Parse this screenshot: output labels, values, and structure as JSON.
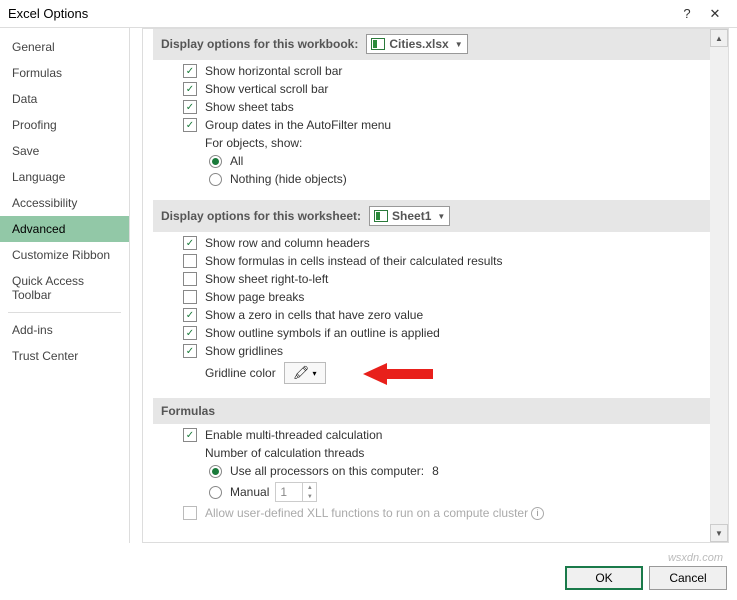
{
  "window": {
    "title": "Excel Options",
    "help": "?",
    "close": "✕"
  },
  "sidebar": {
    "items": [
      "General",
      "Formulas",
      "Data",
      "Proofing",
      "Save",
      "Language",
      "Accessibility",
      "Advanced",
      "Customize Ribbon",
      "Quick Access Toolbar",
      "Add-ins",
      "Trust Center"
    ],
    "selected": "Advanced"
  },
  "workbook_section": {
    "label_cut": "Display options for this workbook:",
    "dropdown_value": "Cities.xlsx",
    "items": {
      "hscroll": "Show horizontal scroll bar",
      "vscroll": "Show vertical scroll bar",
      "tabs": "Show sheet tabs",
      "group_dates": "Group dates in the AutoFilter menu",
      "objects_label": "For objects, show:",
      "all": "All",
      "nothing": "Nothing (hide objects)"
    }
  },
  "worksheet_section": {
    "label": "Display options for this worksheet:",
    "dropdown_value": "Sheet1",
    "items": {
      "headers": "Show row and column headers",
      "formulas": "Show formulas in cells instead of their calculated results",
      "rtl": "Show sheet right-to-left",
      "pgbreaks": "Show page breaks",
      "zero": "Show a zero in cells that have zero value",
      "outline": "Show outline symbols if an outline is applied",
      "gridlines": "Show gridlines",
      "gridcolor": "Gridline color"
    }
  },
  "formulas_section": {
    "label": "Formulas",
    "items": {
      "multi": "Enable multi-threaded calculation",
      "threads_lbl": "Number of calculation threads",
      "allproc": "Use all processors on this computer:",
      "allproc_n": "8",
      "manual": "Manual",
      "manual_val": "1",
      "xll": "Allow user-defined XLL functions to run on a compute cluster"
    }
  },
  "buttons": {
    "ok": "OK",
    "cancel": "Cancel"
  },
  "watermark": "wsxdn.com"
}
